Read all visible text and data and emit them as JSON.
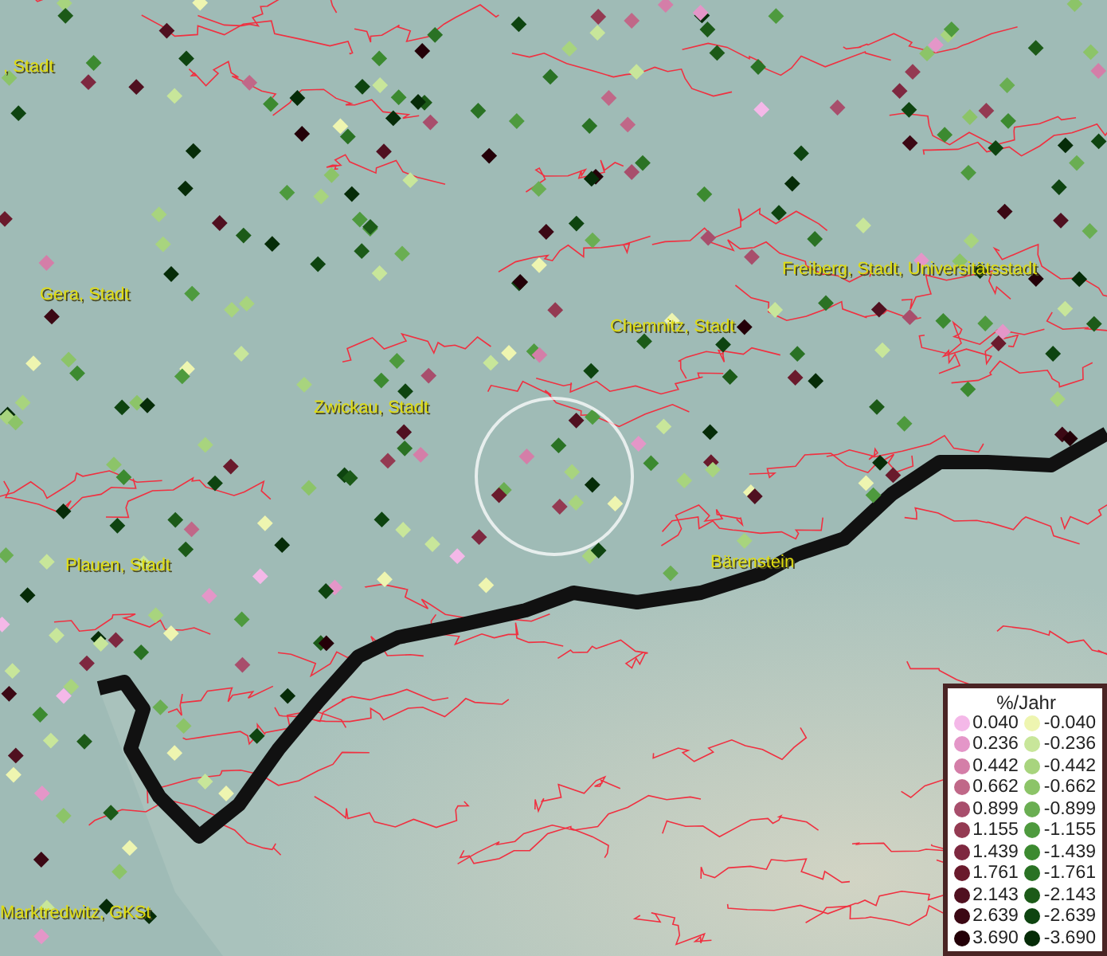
{
  "map": {
    "labels": [
      {
        "text": ", Stadt"
      },
      {
        "text": "Gera, Stadt"
      },
      {
        "text": "Freiberg, Stadt, Universitätsstadt"
      },
      {
        "text": "Chemnitz, Stadt"
      },
      {
        "text": "Zwickau, Stadt"
      },
      {
        "text": "Bärenstein"
      },
      {
        "text": "Plauen, Stadt"
      },
      {
        "text": "Marktredwitz, GKSt"
      }
    ]
  },
  "legend": {
    "title": "%/Jahr",
    "rows": [
      {
        "positive": {
          "label": "0.040",
          "color": "#f4b8e8"
        },
        "negative": {
          "label": "-0.040",
          "color": "#eef5b0"
        }
      },
      {
        "positive": {
          "label": "0.236",
          "color": "#e496c8"
        },
        "negative": {
          "label": "-0.236",
          "color": "#c8e69a"
        }
      },
      {
        "positive": {
          "label": "0.442",
          "color": "#d47ea8"
        },
        "negative": {
          "label": "-0.442",
          "color": "#a8d47e"
        }
      },
      {
        "positive": {
          "label": "0.662",
          "color": "#c06888"
        },
        "negative": {
          "label": "-0.662",
          "color": "#8cc468"
        }
      },
      {
        "positive": {
          "label": "0.899",
          "color": "#a84e6c"
        },
        "negative": {
          "label": "-0.899",
          "color": "#6aae52"
        }
      },
      {
        "positive": {
          "label": "1.155",
          "color": "#943a52"
        },
        "negative": {
          "label": "-1.155",
          "color": "#4e9a3e"
        }
      },
      {
        "positive": {
          "label": "1.439",
          "color": "#7e2840"
        },
        "negative": {
          "label": "-1.439",
          "color": "#3c8a30"
        }
      },
      {
        "positive": {
          "label": "1.761",
          "color": "#6a1a2c"
        },
        "negative": {
          "label": "-1.761",
          "color": "#2a7224"
        }
      },
      {
        "positive": {
          "label": "2.143",
          "color": "#501020"
        },
        "negative": {
          "label": "-2.143",
          "color": "#1c5a18"
        }
      },
      {
        "positive": {
          "label": "2.639",
          "color": "#3c0814"
        },
        "negative": {
          "label": "-2.639",
          "color": "#0e4410"
        }
      },
      {
        "positive": {
          "label": "3.690",
          "color": "#240008"
        },
        "negative": {
          "label": "-3.690",
          "color": "#062c08"
        }
      }
    ]
  }
}
